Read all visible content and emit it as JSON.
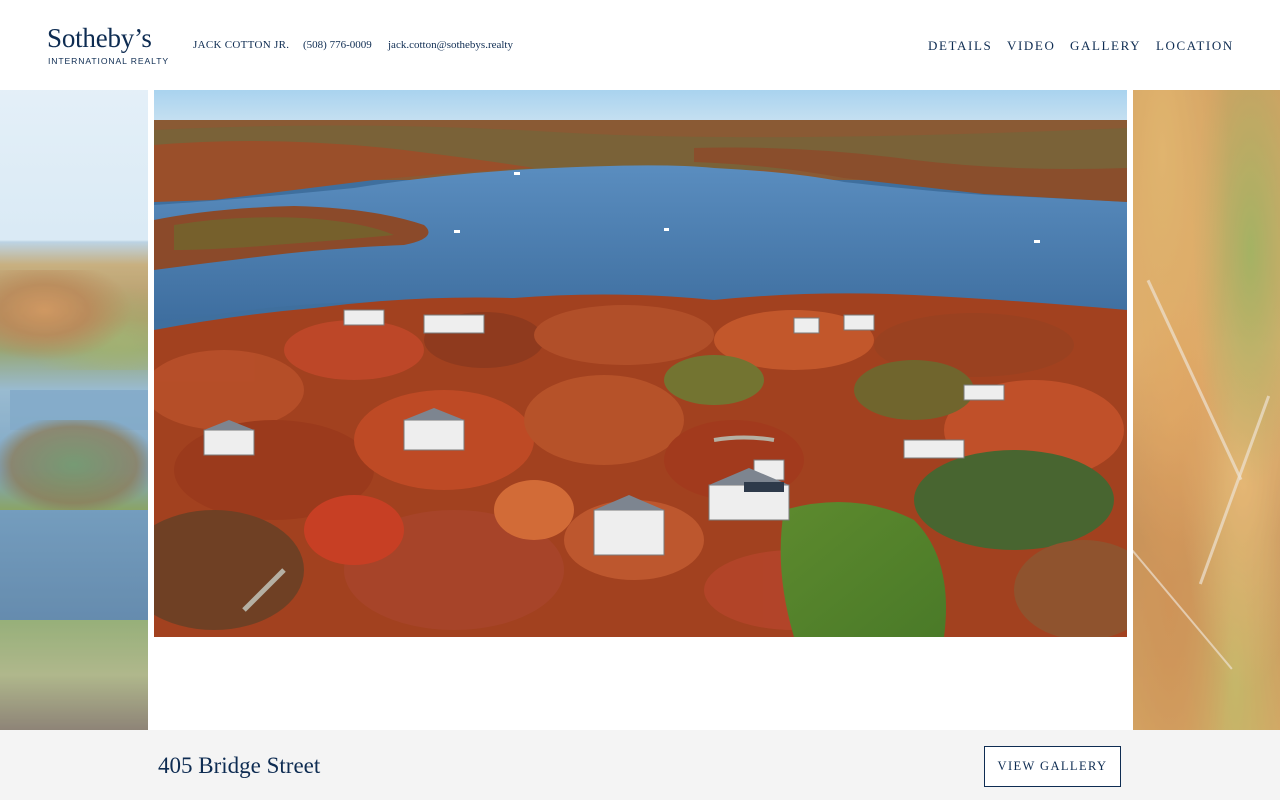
{
  "brand": {
    "name": "Sotheby’s",
    "subtitle": "INTERNATIONAL REALTY"
  },
  "agent": {
    "name": "JACK COTTON JR.",
    "phone": "(508) 776-0009",
    "email": "jack.cotton@sothebys.realty"
  },
  "nav": {
    "items": [
      "DETAILS",
      "VIDEO",
      "GALLERY",
      "LOCATION"
    ]
  },
  "carousel": {
    "slides": [
      "aerial-coastal-neighborhood-left",
      "aerial-harbor-autumn-main",
      "autumn-treetops-right"
    ]
  },
  "listing": {
    "address": "405 Bridge Street",
    "view_gallery_label": "VIEW GALLERY"
  },
  "colors": {
    "brand_navy": "#0e2c52",
    "bottom_bar": "#f4f4f4",
    "background": "#ffffff"
  }
}
